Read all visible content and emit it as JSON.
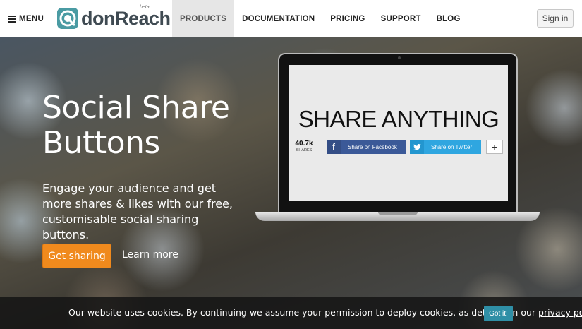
{
  "nav": {
    "menu_label": "MENU",
    "logo_text": "donReach",
    "logo_beta": "beta",
    "items": [
      {
        "label": "PRODUCTS",
        "active": true
      },
      {
        "label": "DOCUMENTATION",
        "active": false
      },
      {
        "label": "PRICING",
        "active": false
      },
      {
        "label": "SUPPORT",
        "active": false
      },
      {
        "label": "BLOG",
        "active": false
      }
    ],
    "signin_label": "Sign in"
  },
  "hero": {
    "title_line1": "Social Share",
    "title_line2": "Buttons",
    "subtitle": "Engage your audience and get more shares & likes with our free, customisable social sharing buttons.",
    "primary_button": "Get sharing",
    "secondary_link": "Learn more"
  },
  "laptop": {
    "headline": "SHARE ANYTHING",
    "share_count": "40.7k",
    "share_count_label": "SHARES",
    "facebook_label": "Share on Facebook",
    "twitter_label": "Share on Twitter",
    "plus_label": "+",
    "facebook_color": "#3b5998",
    "twitter_color": "#2fa6e0"
  },
  "cookie": {
    "message": "Our website uses cookies. By continuing we assume your permission to deploy cookies, as detailed in our ",
    "policy_link": "privacy policy",
    "period": ".",
    "button": "Got it!"
  },
  "colors": {
    "accent_orange": "#f08a1d",
    "brand_teal": "#4a9ba3",
    "cookie_button": "#2f8fa6"
  }
}
